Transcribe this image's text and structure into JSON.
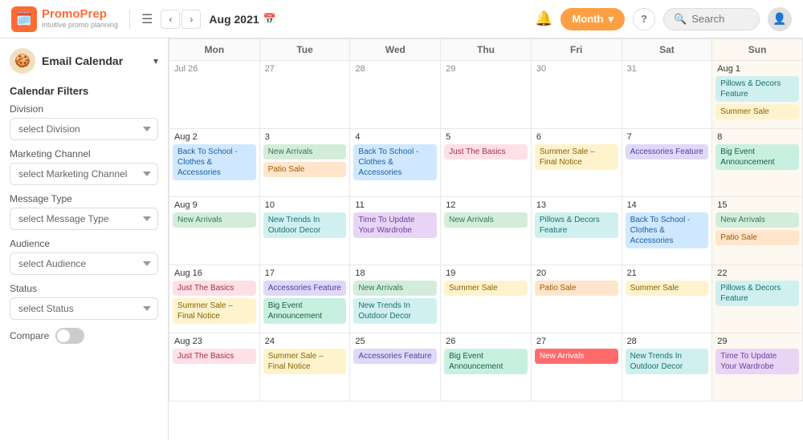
{
  "header": {
    "logo_name": "PromoPrep",
    "logo_tagline": "intuitive promo planning",
    "month_year": "Aug 2021",
    "month_btn_label": "Month",
    "search_placeholder": "Search",
    "help_label": "?"
  },
  "sidebar": {
    "email_calendar_label": "Email Calendar",
    "filter_title": "Calendar Filters",
    "division_label": "Division",
    "division_placeholder": "select Division",
    "marketing_channel_label": "Marketing Channel",
    "marketing_channel_placeholder": "select Marketing Channel",
    "message_type_label": "Message Type",
    "message_type_placeholder": "select Message Type",
    "audience_label": "Audience",
    "audience_placeholder": "select Audience",
    "status_label": "Status",
    "status_placeholder": "select Status",
    "compare_label": "Compare"
  },
  "calendar": {
    "day_headers": [
      "Mon",
      "Tue",
      "Wed",
      "Thu",
      "Fri",
      "Sat",
      "Sun"
    ],
    "weeks": [
      {
        "days": [
          {
            "number": "Jul 26",
            "current": false,
            "events": []
          },
          {
            "number": "27",
            "current": false,
            "events": []
          },
          {
            "number": "28",
            "current": false,
            "events": []
          },
          {
            "number": "29",
            "current": false,
            "events": []
          },
          {
            "number": "30",
            "current": false,
            "events": []
          },
          {
            "number": "31",
            "current": false,
            "events": []
          },
          {
            "number": "Aug 1",
            "current": true,
            "sunday": true,
            "events": [
              {
                "label": "Pillows & Decors Feature",
                "color": "teal"
              },
              {
                "label": "Summer Sale",
                "color": "yellow"
              }
            ]
          }
        ]
      },
      {
        "days": [
          {
            "number": "Aug 2",
            "current": true,
            "events": [
              {
                "label": "Back To School - Clothes & Accessories",
                "color": "blue"
              }
            ]
          },
          {
            "number": "3",
            "current": true,
            "events": [
              {
                "label": "New Arrivals",
                "color": "green"
              },
              {
                "label": "Patio Sale",
                "color": "orange"
              }
            ]
          },
          {
            "number": "4",
            "current": true,
            "events": [
              {
                "label": "Back To School - Clothes & Accessories",
                "color": "blue"
              }
            ]
          },
          {
            "number": "5",
            "current": true,
            "events": [
              {
                "label": "Just The Basics",
                "color": "pink"
              }
            ]
          },
          {
            "number": "6",
            "current": true,
            "events": [
              {
                "label": "Summer Sale – Final Notice",
                "color": "yellow"
              }
            ]
          },
          {
            "number": "7",
            "current": true,
            "events": [
              {
                "label": "Accessories Feature",
                "color": "lavender"
              }
            ]
          },
          {
            "number": "8",
            "current": true,
            "sunday": true,
            "events": [
              {
                "label": "Big Event Announcement",
                "color": "mint"
              }
            ]
          }
        ]
      },
      {
        "days": [
          {
            "number": "Aug 9",
            "current": true,
            "events": [
              {
                "label": "New Arrivals",
                "color": "green"
              }
            ]
          },
          {
            "number": "10",
            "current": true,
            "events": [
              {
                "label": "New Trends In Outdoor Decor",
                "color": "teal"
              }
            ]
          },
          {
            "number": "11",
            "current": true,
            "events": [
              {
                "label": "Time To Update Your Wardrobe",
                "color": "purple"
              }
            ]
          },
          {
            "number": "12",
            "current": true,
            "events": [
              {
                "label": "New Arrivals",
                "color": "green"
              }
            ]
          },
          {
            "number": "13",
            "current": true,
            "events": [
              {
                "label": "Pillows & Decors Feature",
                "color": "teal"
              }
            ]
          },
          {
            "number": "14",
            "current": true,
            "events": [
              {
                "label": "Back To School - Clothes & Accessories",
                "color": "blue"
              }
            ]
          },
          {
            "number": "15",
            "current": true,
            "sunday": true,
            "events": [
              {
                "label": "New Arrivals",
                "color": "green"
              },
              {
                "label": "Patio Sale",
                "color": "orange"
              }
            ]
          }
        ]
      },
      {
        "days": [
          {
            "number": "Aug 16",
            "current": true,
            "events": [
              {
                "label": "Just The Basics",
                "color": "pink"
              },
              {
                "label": "Summer Sale – Final Notice",
                "color": "yellow"
              }
            ]
          },
          {
            "number": "17",
            "current": true,
            "events": [
              {
                "label": "Accessories Feature",
                "color": "lavender"
              },
              {
                "label": "Big Event Announcement",
                "color": "mint"
              }
            ]
          },
          {
            "number": "18",
            "current": true,
            "events": [
              {
                "label": "New Arrivals",
                "color": "green"
              },
              {
                "label": "New Trends In Outdoor Decor",
                "color": "teal"
              }
            ]
          },
          {
            "number": "19",
            "current": true,
            "events": [
              {
                "label": "Summer Sale",
                "color": "yellow"
              }
            ]
          },
          {
            "number": "20",
            "current": true,
            "events": [
              {
                "label": "Patio Sale",
                "color": "orange"
              }
            ]
          },
          {
            "number": "21",
            "current": true,
            "events": [
              {
                "label": "Summer Sale",
                "color": "yellow"
              }
            ]
          },
          {
            "number": "22",
            "current": true,
            "sunday": true,
            "events": [
              {
                "label": "Pillows & Decors Feature",
                "color": "teal"
              }
            ]
          }
        ]
      },
      {
        "days": [
          {
            "number": "Aug 23",
            "current": true,
            "events": [
              {
                "label": "Just The Basics",
                "color": "pink"
              }
            ]
          },
          {
            "number": "24",
            "current": true,
            "events": [
              {
                "label": "Summer Sale – Final Notice",
                "color": "yellow"
              }
            ]
          },
          {
            "number": "25",
            "current": true,
            "events": [
              {
                "label": "Accessories Feature",
                "color": "lavender"
              }
            ]
          },
          {
            "number": "26",
            "current": true,
            "events": [
              {
                "label": "Big Event Announcement",
                "color": "mint"
              }
            ]
          },
          {
            "number": "27",
            "current": true,
            "events": [
              {
                "label": "New Arrivals",
                "color": "red"
              }
            ]
          },
          {
            "number": "28",
            "current": true,
            "events": [
              {
                "label": "New Trends In Outdoor Decor",
                "color": "teal"
              }
            ]
          },
          {
            "number": "29",
            "current": true,
            "sunday": true,
            "events": [
              {
                "label": "Time To Update Your Wardrobe",
                "color": "purple"
              }
            ]
          }
        ]
      }
    ]
  }
}
